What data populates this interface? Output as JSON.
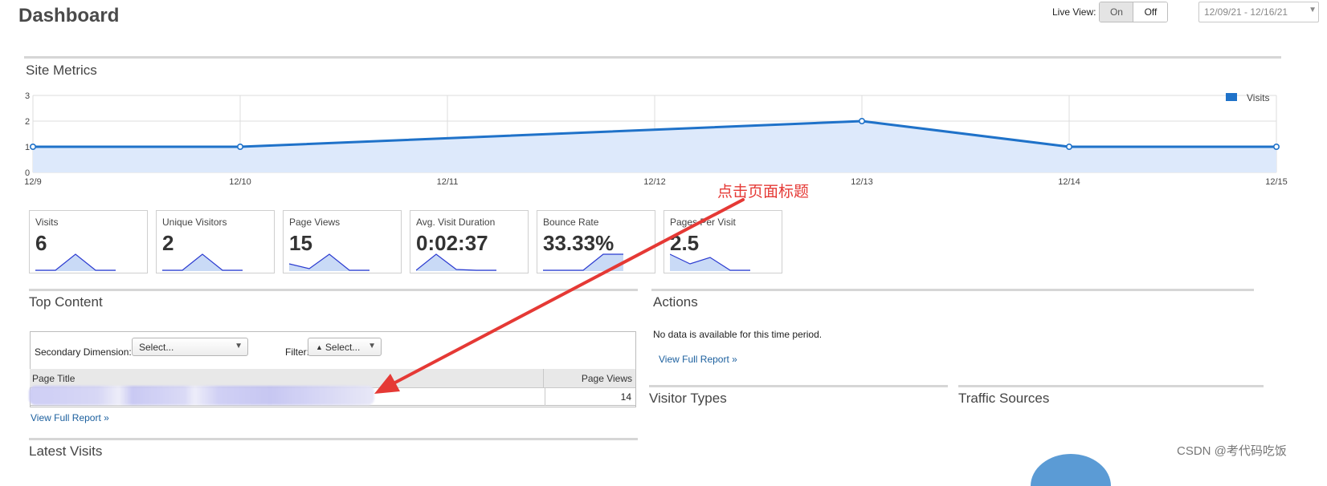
{
  "header": {
    "title": "Dashboard",
    "live_view_label": "Live View:",
    "live_view_on": "On",
    "live_view_off": "Off",
    "date_range": "12/09/21 - 12/16/21"
  },
  "site_metrics": {
    "title": "Site Metrics"
  },
  "chart_data": {
    "type": "area",
    "categories": [
      "12/9",
      "12/10",
      "12/11",
      "12/12",
      "12/13",
      "12/14",
      "12/15"
    ],
    "points": [
      [
        0,
        1
      ],
      [
        1,
        1
      ],
      [
        4,
        2
      ],
      [
        5,
        1
      ],
      [
        6,
        1
      ]
    ],
    "series": [
      {
        "name": "Visits",
        "values": [
          1,
          1,
          null,
          null,
          2,
          1,
          1
        ]
      }
    ],
    "ylim": [
      0,
      3
    ],
    "yticks": [
      "0",
      "1",
      "2",
      "3"
    ],
    "legend": "top-right",
    "grid": true,
    "line_color": "#1f72c9",
    "fill_color": "#dde9fb"
  },
  "metrics": [
    {
      "label": "Visits",
      "value": "6",
      "spark": [
        0,
        0,
        1,
        0,
        0
      ]
    },
    {
      "label": "Unique Visitors",
      "value": "2",
      "spark": [
        0,
        0,
        1,
        0,
        0
      ]
    },
    {
      "label": "Page Views",
      "value": "15",
      "spark": [
        0.4,
        0.1,
        1,
        0,
        0
      ]
    },
    {
      "label": "Avg. Visit Duration",
      "value": "0:02:37",
      "spark": [
        0,
        1,
        0.05,
        0,
        0
      ]
    },
    {
      "label": "Bounce Rate",
      "value": "33.33%",
      "spark": [
        0,
        0,
        0,
        1,
        1
      ]
    },
    {
      "label": "Pages Per Visit",
      "value": "2.5",
      "spark": [
        1,
        0.4,
        0.8,
        0,
        0
      ]
    }
  ],
  "top_content": {
    "title": "Top Content",
    "secondary_dimension_label": "Secondary Dimension:",
    "secondary_dimension_value": "Select...",
    "filter_label": "Filter:",
    "filter_value": "Select...",
    "columns": [
      "Page Title",
      "Page Views"
    ],
    "rows": [
      {
        "page_views": "14"
      }
    ],
    "view_full_report": "View Full Report »"
  },
  "actions": {
    "title": "Actions",
    "empty_message": "No data is available for this time period.",
    "view_full_report": "View Full Report »"
  },
  "visitor_types": {
    "title": "Visitor Types"
  },
  "traffic_sources": {
    "title": "Traffic Sources"
  },
  "latest_visits": {
    "title": "Latest Visits"
  },
  "annotation": {
    "text": "点击页面标题",
    "color": "#e53935"
  },
  "watermark": "CSDN @考代码吃饭"
}
